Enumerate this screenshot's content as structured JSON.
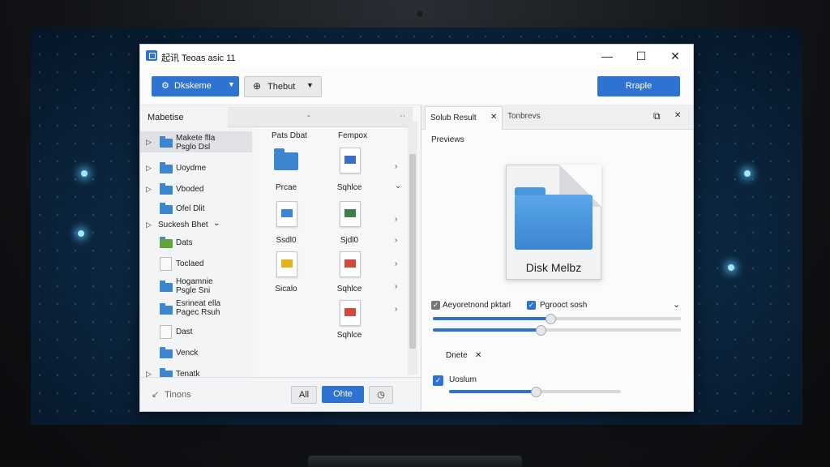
{
  "window": {
    "title": "起讯 Teoas asic 11",
    "minimize": "—",
    "maximize": "☐",
    "close": "✕"
  },
  "toolbar": {
    "primary_dropdown_label": "Dkskeme",
    "secondary_dropdown_label": "Thebut",
    "right_button_label": "Rraple"
  },
  "tree": {
    "header": "Mabetise",
    "items": [
      {
        "label_1": "Makete flla",
        "label_2": "Psglo Dsl",
        "icon": "folder-icon",
        "chevron": "▷",
        "selected": true
      },
      {
        "label_1": "Uoydme",
        "icon": "folder-icon",
        "chevron": "▷"
      },
      {
        "label_1": "Vboded",
        "icon": "folder-icon",
        "chevron": "▷"
      },
      {
        "label_1": "Ofel Dlit",
        "icon": "folder-icon",
        "chevron": ""
      },
      {
        "label_1": "Suckesh Bhet",
        "icon": "",
        "chevron": "▷",
        "trailing": "⌄"
      },
      {
        "label_1": "Dats",
        "icon": "folder-green-icon",
        "chevron": ""
      },
      {
        "label_1": "Toclaed",
        "icon": "file-icon",
        "chevron": ""
      },
      {
        "label_1": "Hogamnie",
        "label_2": "Psgle Sni",
        "icon": "folder-icon",
        "chevron": ""
      },
      {
        "label_1": "Esrineat ella",
        "label_2": "Pagec Rsuh",
        "icon": "folder-icon",
        "chevron": ""
      },
      {
        "label_1": "Dast",
        "icon": "file-icon",
        "chevron": ""
      },
      {
        "label_1": "Venck",
        "icon": "folder-icon",
        "chevron": ""
      },
      {
        "label_1": "Tenatk",
        "icon": "folder-icon",
        "chevron": "▷"
      }
    ]
  },
  "grid": {
    "header_arrow_1": "-",
    "header_arrow_2": "··",
    "col_1_label": "Pats Dbat",
    "col_2_label": "Fempox",
    "items": [
      {
        "label": "Prcae",
        "icon": "folder-icon"
      },
      {
        "label": "Sqhlce",
        "icon": "blue-doc-icon"
      },
      {
        "label": "Ssdl0",
        "icon": "folder-doc-icon"
      },
      {
        "label": "Sjdl0",
        "icon": "image-doc-icon"
      },
      {
        "label": "Sicalo",
        "icon": "pencil-doc-icon"
      },
      {
        "label": "Sqhlce",
        "icon": "red-doc-icon"
      },
      {
        "label": "Sqhlce",
        "icon": "red-doc-icon"
      }
    ],
    "row_arrows": [
      "›",
      "⌄",
      "›",
      "›",
      "›",
      "›",
      "›"
    ]
  },
  "bottombar": {
    "left_label": "Tinons",
    "left_icon": "arrow-icon",
    "btn_small_label": "All",
    "btn_primary_label": "Ohte",
    "btn_icon": "clock-icon"
  },
  "right": {
    "tab_active_label": "Solub Result",
    "tab_active_close": "✕",
    "tab_inactive_label": "Tonbrevs",
    "popout_icon": "⧉",
    "close_icon": "✕",
    "previews_label": "Previews",
    "preview_file_label": "Disk Melbz",
    "opt1_label": "Aeyoretnond pktarl",
    "opt2_label": "Pgrooct sosh",
    "dropdown_chev": "⌄",
    "slider1": 0.47,
    "slider2": 0.43,
    "tag_label": "Dnete",
    "tag_close": "✕",
    "opt3_label": "Uoslum",
    "slider3": 0.5
  },
  "colors": {
    "accent": "#2f73d2",
    "folder": "#3b86cf",
    "screen_bg": "#0d2a45"
  }
}
